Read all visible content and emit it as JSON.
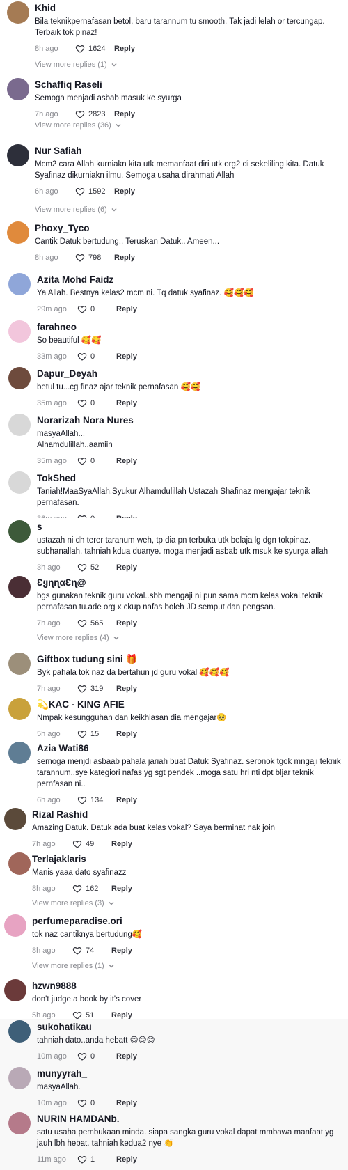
{
  "comments": [
    {
      "user": "Khid",
      "text": "Bila teknikpernafasan betol, baru tarannum tu smooth. Tak jadi lelah or tercungap. Terbaik tok pinaz!",
      "time": "8h ago",
      "likes": "1624",
      "reply": "Reply",
      "more": "View more replies (1)",
      "avatar_color": "#a57b54"
    },
    {
      "user": "Schaffiq Raseli",
      "text": "Semoga menjadi asbab masuk ke syurga",
      "time": "7h ago",
      "likes": "2823",
      "reply": "Reply",
      "more": "View more replies (36)",
      "avatar_color": "#7a6a8e"
    },
    {
      "user": "Nur Safiah",
      "text": "Mcm2 cara Allah kurniakn kita utk memanfaat diri utk org2 di sekeliling kita. Datuk Syafinaz dikurniakn ilmu. Semoga usaha dirahmati Allah",
      "time": "6h ago",
      "likes": "1592",
      "reply": "Reply",
      "more": "View more replies (6)",
      "avatar_color": "#2d2f3a"
    },
    {
      "user": "Phoxy_Tyco",
      "text": "Cantik Datuk bertudung.. Teruskan Datuk.. Ameen...",
      "time": "8h ago",
      "likes": "798",
      "reply": "Reply",
      "more": "",
      "avatar_color": "#e08a3c"
    },
    {
      "user": "Azita Mohd Faidz",
      "text": "Ya Allah. Bestnya kelas2 mcm ni. Tq datuk syafinaz. 🥰🥰🥰",
      "time": "29m ago",
      "likes": "0",
      "reply": "Reply",
      "more": "",
      "avatar_color": "#8fa6d9"
    },
    {
      "user": "farahneo",
      "text": "So beautiful 🥰🥰",
      "time": "33m ago",
      "likes": "0",
      "reply": "Reply",
      "more": "",
      "avatar_color": "#f2c6dc"
    },
    {
      "user": "Dapur_Deyah",
      "text": "betul tu...cg finaz ajar teknik pernafasan 🥰🥰",
      "time": "35m ago",
      "likes": "0",
      "reply": "Reply",
      "more": "",
      "avatar_color": "#6e4b3d"
    },
    {
      "user": "Norarizah Nora Nures",
      "text": "masyaAllah...\nAlhamdulillah..aamiin",
      "time": "35m ago",
      "likes": "0",
      "reply": "Reply",
      "more": "",
      "avatar_color": "#d8d8d8"
    },
    {
      "user": "TokShed",
      "text": "Taniah!MaaSyaAllah.Syukur Alhamdulillah Ustazah Shafinaz mengajar teknik pernafasan.",
      "time": "36m ago",
      "likes": "0",
      "reply": "Reply",
      "more": "",
      "avatar_color": "#d8d8d8"
    },
    {
      "user": "s",
      "text": "ustazah ni dh terer taranum weh, tp dia pn terbuka utk belaja lg dgn tokpinaz. subhanallah. tahniah kdua duanye. moga menjadi asbab utk msuk ke syurga allah",
      "time": "3h ago",
      "likes": "52",
      "reply": "Reply",
      "more": "",
      "avatar_color": "#3d5a3a"
    },
    {
      "user": "ƐყɳɳαƐɳ@",
      "text": "bgs gunakan teknik guru vokal..sbb mengaji ni pun sama mcm kelas vokal.teknik pernafasan tu.ade org x ckup nafas boleh JD semput dan pengsan.",
      "time": "7h ago",
      "likes": "565",
      "reply": "Reply",
      "more": "View more replies (4)",
      "avatar_color": "#4a2e35"
    },
    {
      "user": "Giftbox tudung sini 🎁",
      "text": "Byk pahala tok naz da bertahun jd guru vokal 🥰🥰🥰",
      "time": "7h ago",
      "likes": "319",
      "reply": "Reply",
      "more": "",
      "avatar_color": "#9c8f7a"
    },
    {
      "user": "💫KAC - KING AFIE",
      "text": "Nmpak kesungguhan dan keikhlasan dia mengajar🥺",
      "time": "5h ago",
      "likes": "15",
      "reply": "Reply",
      "more": "",
      "avatar_color": "#c9a13b"
    },
    {
      "user": "Azia Wati86",
      "text": "semoga menjdi asbaab pahala jariah buat Datuk Syafinaz. seronok tgok mngaji teknik tarannum..sye kategiori nafas yg sgt pendek ..moga satu hri nti dpt bljar teknik pernfasan ni..",
      "time": "6h ago",
      "likes": "134",
      "reply": "Reply",
      "more": "",
      "avatar_color": "#5f7d94"
    },
    {
      "user": "Rizal Rashid",
      "text": "Amazing Datuk. Datuk ada buat kelas vokal? Saya berminat nak join",
      "time": "7h ago",
      "likes": "49",
      "reply": "Reply",
      "more": "",
      "avatar_color": "#5b4a3a"
    },
    {
      "user": "Terlajaklaris",
      "text": "Manis yaaa dato syafinazz",
      "time": "8h ago",
      "likes": "162",
      "reply": "Reply",
      "more": "View more replies (3)",
      "avatar_color": "#a0665a"
    },
    {
      "user": "perfumeparadise.ori",
      "text": "tok naz cantiknya bertudung🥰",
      "time": "8h ago",
      "likes": "74",
      "reply": "Reply",
      "more": "View more replies (1)",
      "avatar_color": "#e7a3c2"
    },
    {
      "user": "hzwn9888",
      "text": "don't judge a book by it's cover",
      "time": "5h ago",
      "likes": "51",
      "reply": "Reply",
      "more": "",
      "avatar_color": "#6b3a3a"
    },
    {
      "user": "sukohatikau",
      "text": "tahniah dato..anda hebatt 😊😊😊",
      "time": "10m ago",
      "likes": "0",
      "reply": "Reply",
      "more": "",
      "avatar_color": "#3e5f78"
    },
    {
      "user": "munyyrah_",
      "text": "masyaAllah.",
      "time": "10m ago",
      "likes": "0",
      "reply": "Reply",
      "more": "",
      "avatar_color": "#b9a9b6"
    },
    {
      "user": "NURIN HAMDANb.",
      "text": "satu usaha pembukaan minda. siapa sangka guru vokal dapat mmbawa manfaat yg jauh lbh hebat. tahniah kedua2 nye 👏",
      "time": "11m ago",
      "likes": "1",
      "reply": "Reply",
      "more": "",
      "avatar_color": "#b57a8a"
    }
  ]
}
